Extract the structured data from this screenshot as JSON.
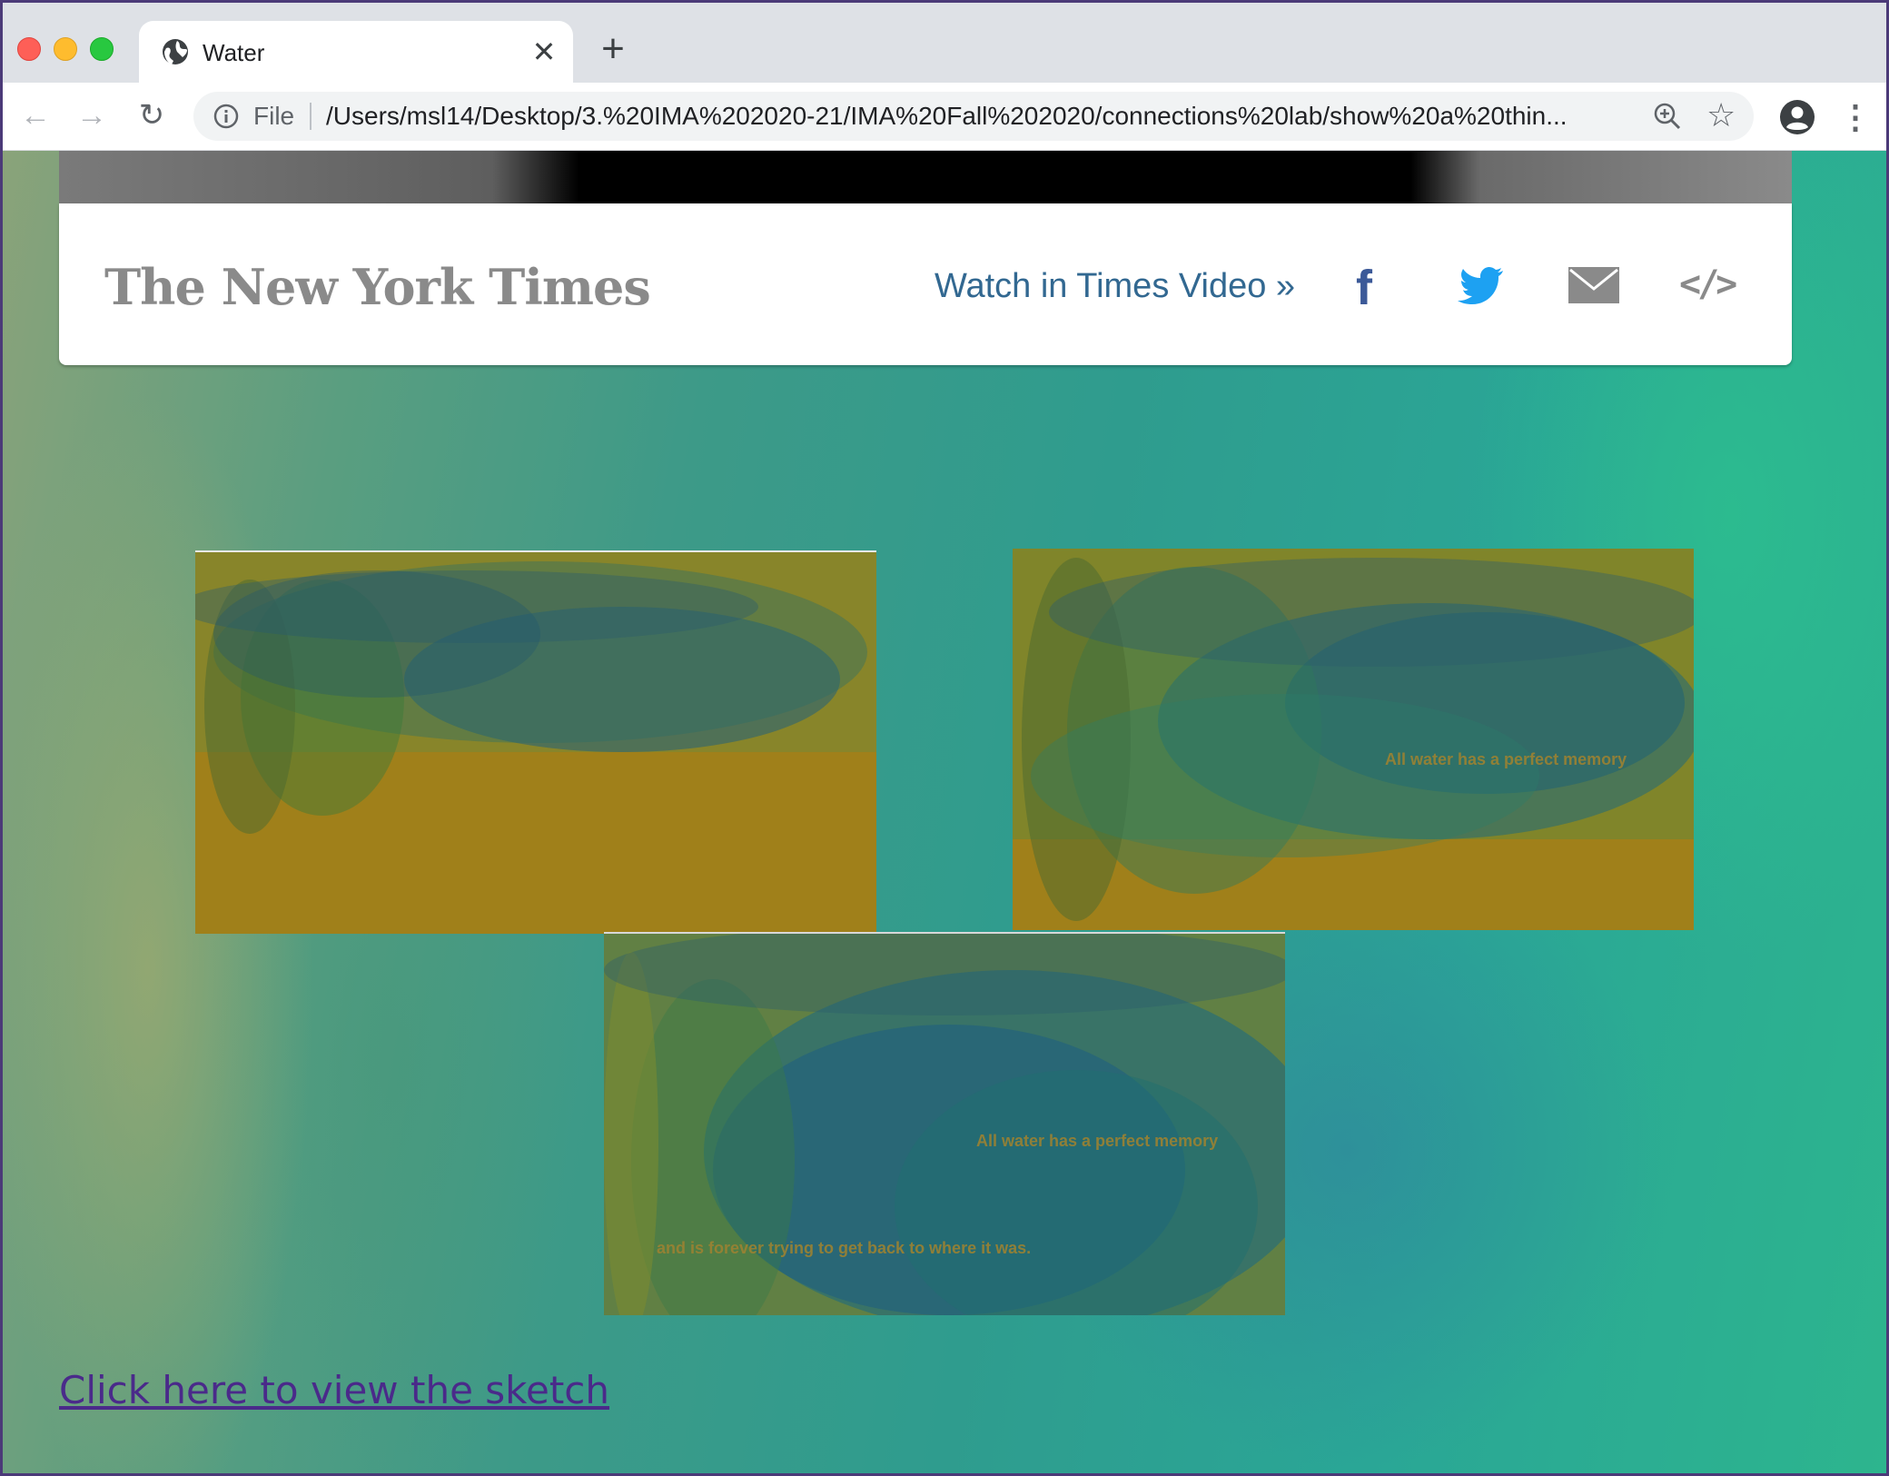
{
  "browser": {
    "tab_title": "Water",
    "tab_close": "✕",
    "new_tab": "+",
    "file_label": "File",
    "url": "/Users/msl14/Desktop/3.%20IMA%202020-21/IMA%20Fall%202020/connections%20lab/show%20a%20thin...",
    "nav": {
      "back": "←",
      "forward": "→",
      "reload": "↻"
    },
    "star": "☆",
    "menu": "⋮"
  },
  "video_bar": {
    "logo": "The New York Times",
    "watch_link": "Watch in Times Video »",
    "facebook": "f",
    "embed": "</>"
  },
  "sketches": [
    {
      "texts": []
    },
    {
      "texts": [
        "All water has a perfect memory"
      ]
    },
    {
      "texts": [
        "All water has a perfect memory",
        "and is forever trying to get back to where it was."
      ]
    }
  ],
  "footer": {
    "link_text": "Click here to view the sketch"
  },
  "colors": {
    "link_visited": "#4a2a8a",
    "nyt_blue": "#326891",
    "facebook": "#3b5998",
    "twitter": "#1da1f2"
  }
}
